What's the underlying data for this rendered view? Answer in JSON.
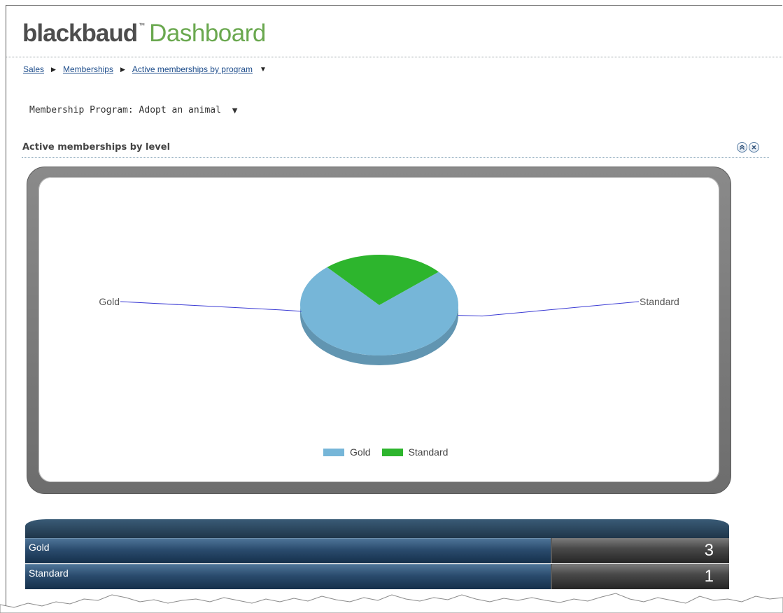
{
  "brand": {
    "name": "blackbaud",
    "tm": "™",
    "product": "Dashboard"
  },
  "breadcrumb": {
    "items": [
      "Sales",
      "Memberships",
      "Active memberships by program"
    ]
  },
  "filter": {
    "label": "Membership Program:",
    "value": "Adopt an animal"
  },
  "section": {
    "title": "Active memberships by level",
    "collapse_icon": "double-chevron-up-icon",
    "close_icon": "close-icon"
  },
  "chart_data": {
    "type": "pie",
    "categories": [
      "Gold",
      "Standard"
    ],
    "values": [
      3,
      1
    ],
    "colors": [
      "#76b6d8",
      "#2db52d"
    ],
    "legend": [
      "Gold",
      "Standard"
    ],
    "legend_position": "bottom"
  },
  "grid": {
    "rows": [
      {
        "label": "Gold",
        "value": "3"
      },
      {
        "label": "Standard",
        "value": "1"
      }
    ]
  }
}
